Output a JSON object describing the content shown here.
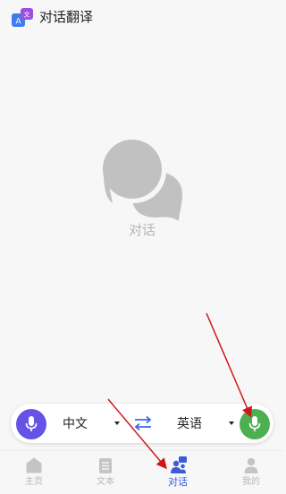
{
  "app": {
    "title": "对话翻译",
    "logo_letter_a": "A",
    "logo_letter_wen": "文"
  },
  "empty_state": {
    "icon": "chat-bubbles-icon",
    "label": "对话"
  },
  "language_bar": {
    "source_language": "中文",
    "target_language": "英语",
    "left_mic_color": "#6552e6",
    "right_mic_color": "#4caf50",
    "swap_icon": "swap-arrows-icon"
  },
  "bottom_nav": {
    "items": [
      {
        "label": "主页",
        "icon": "home-icon",
        "active": false
      },
      {
        "label": "文本",
        "icon": "document-icon",
        "active": false
      },
      {
        "label": "对话",
        "icon": "dialogue-icon",
        "active": true
      },
      {
        "label": "我的",
        "icon": "person-icon",
        "active": false
      }
    ],
    "active_color": "#3d5bd9"
  }
}
